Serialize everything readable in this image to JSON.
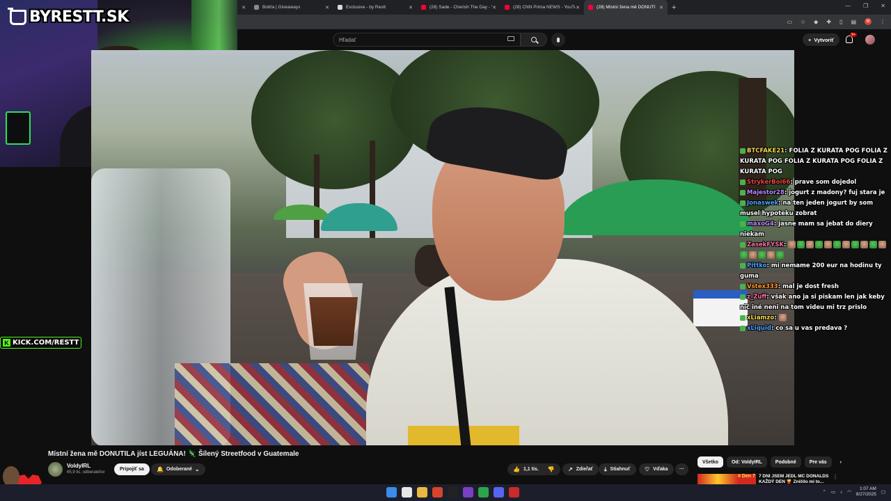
{
  "overlay": {
    "logo_text": "BYRESTT.SK",
    "kick_k": "K",
    "kick_text": "KICK.COM/RESTT"
  },
  "browser": {
    "tabs": [
      {
        "label": "Botiťa | Giveaways",
        "icon": "page-icon"
      },
      {
        "label": "Exclusive - by Restt",
        "icon": "page-icon"
      },
      {
        "label": "(28) Sade - Cherish The Day - Y",
        "icon": "youtube-icon"
      },
      {
        "label": "(28) CNN Prima NEWS - YouTub",
        "icon": "youtube-icon"
      },
      {
        "label": "(28) Místní žena mě DONUTI",
        "icon": "youtube-icon"
      }
    ],
    "new_tab": "+"
  },
  "youtube": {
    "search_placeholder": "Hľadať",
    "create_label": "Vytvoriť",
    "notif_count": "9+"
  },
  "chat": [
    {
      "user": "BTCFAKE21",
      "user_color": "#f2d94e",
      "text": "FOLIA Z KURATA POG FOLIA Z KURATA POG FOLIA Z KURATA POG FOLIA Z KURATA POG",
      "emotes": 0
    },
    {
      "user": "StrykerBoi66",
      "user_color": "#e84545",
      "text": "prave som dojedol",
      "emotes": 0
    },
    {
      "user": "Majestor28",
      "user_color": "#b78bff",
      "text": "jogurt z madony? fuj stara je",
      "emotes": 0
    },
    {
      "user": "Jonaswek",
      "user_color": "#4aa3ff",
      "text": "na ten jeden jogurt by som musel hypoteku zobrat",
      "emotes": 0
    },
    {
      "user": "maxoG4",
      "user_color": "#b78bff",
      "text": "jasne mam sa jebat do diery niekam",
      "emotes": 0
    },
    {
      "user": "ZasekFYSK",
      "user_color": "#ff6fa8",
      "text": "",
      "emotes": 16
    },
    {
      "user": "Pittko",
      "user_color": "#4aa3ff",
      "text": "mi nemame 200 eur na hodinu ty guma",
      "emotes": 0
    },
    {
      "user": "Vstex333",
      "user_color": "#ff9a2e",
      "text": "mal je dost fresh",
      "emotes": 0
    },
    {
      "user": "z_Zuff",
      "user_color": "#ff6fa8",
      "text": "však ano ja si piskam len jak keby nič iné neni na tom videu mi trz prislo",
      "emotes": 0
    },
    {
      "user": "xLiamzo",
      "user_color": "#f2d94e",
      "text": "",
      "emotes": 1
    },
    {
      "user": "xLiquid",
      "user_color": "#4aa3ff",
      "text": "co sa u vas predava ?",
      "emotes": 0
    }
  ],
  "video_info": {
    "title": "Místní žena mě DONUTILA jíst LEGUÁNA! 🦎 Šílený Streetfood v Guatemale",
    "channel": "VoldyIRL",
    "subscribers": "65,9 tis. odberateľov",
    "join_label": "Pripojiť sa",
    "subscribed_label": "Odoberané",
    "likes": "1,1 tis.",
    "share_label": "Zdieľať",
    "download_label": "Stiahnuť",
    "thanks_label": "Vďaka",
    "more": "···"
  },
  "chips": [
    "Všetko",
    "Od: VoldyIRL",
    "Podobné",
    "Pre vás"
  ],
  "recommendation": {
    "thumb_text": "# Den 7",
    "title": "7 DNÍ JSEM JEDL MC DONALDS KAŽDÝ DEN 🍟 Zničilo mi to..."
  },
  "taskbar": {
    "time": "1:07 AM",
    "date": "8/27/2025"
  },
  "colors": {
    "kick_green": "#53fc18",
    "yt_red": "#ff0033",
    "accent_blue": "#3ea6ff"
  }
}
